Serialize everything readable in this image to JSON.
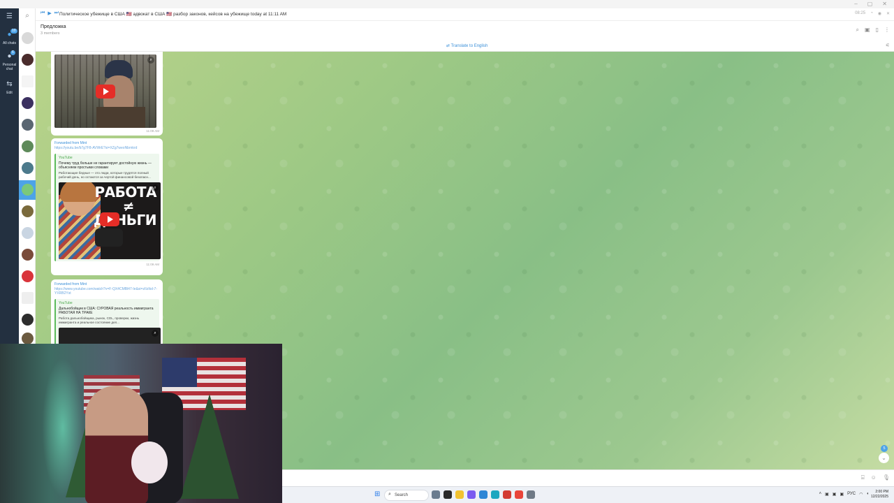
{
  "window": {
    "controls": [
      "–",
      "▢",
      "✕"
    ]
  },
  "rail": {
    "all_chats_label": "All chats",
    "all_chats_badge": "10",
    "personal_label": "Personal chat",
    "personal_badge": "6",
    "edit_label": "Edit"
  },
  "pinned": {
    "text": "Политическое убежище в США 🇺🇸 адвокат в США 🇺🇸 разбор законов, кейсов на убежище today at 11:11 AM",
    "time": "08:25"
  },
  "header": {
    "title": "Предложка",
    "subtitle": "3 members"
  },
  "translate": {
    "label": "Translate to English"
  },
  "messages": [
    {
      "time": "11:09 AM"
    },
    {
      "forwarded_from": "Forwarded from Mint",
      "link": "https://youtu.be/b7g7F8-AVWrE?si=XZg7weoNbrnkrd",
      "site": "YouTube",
      "title": "Почему труд больше не гарантирует достойную жизнь — объясняем простыми словами",
      "description": "Работающие бедные — это люди, которые трудятся полный рабочий день, но остаются за чертой финансовой безопасн...",
      "thumb_text_1": "РАБОТА",
      "thumb_text_2": "≠",
      "thumb_text_3": "ДЕНЬГИ",
      "time": "11:09 AM"
    },
    {
      "forwarded_from": "Forwarded from Mint",
      "link": "https://www.youtube.com/watch?v=F-QX4CMBl47-Ie&si=zIIzIkd-7-YXRB2Yst",
      "site": "YouTube",
      "title": "Дальнобойщик в США: СУРОВАЯ реальность иммигранта РАБОТАЯ НА ТРАКЕ",
      "description": "Работа дальнобойщика, рынок, CDL, проверки, жизнь иммигранта и реальное состояние дел..."
    }
  ],
  "scroll": {
    "badge": "5",
    "arrow": "⌄"
  },
  "taskbar": {
    "search_label": "Search",
    "tray_lang": "РУС",
    "clock_time": "2:00 PM",
    "clock_date": "12/22/2025"
  },
  "colors": {
    "rail": "#233040",
    "accent": "#3a8fd8",
    "youtube_green": "#4ca84c",
    "play_red": "#e52d27"
  }
}
